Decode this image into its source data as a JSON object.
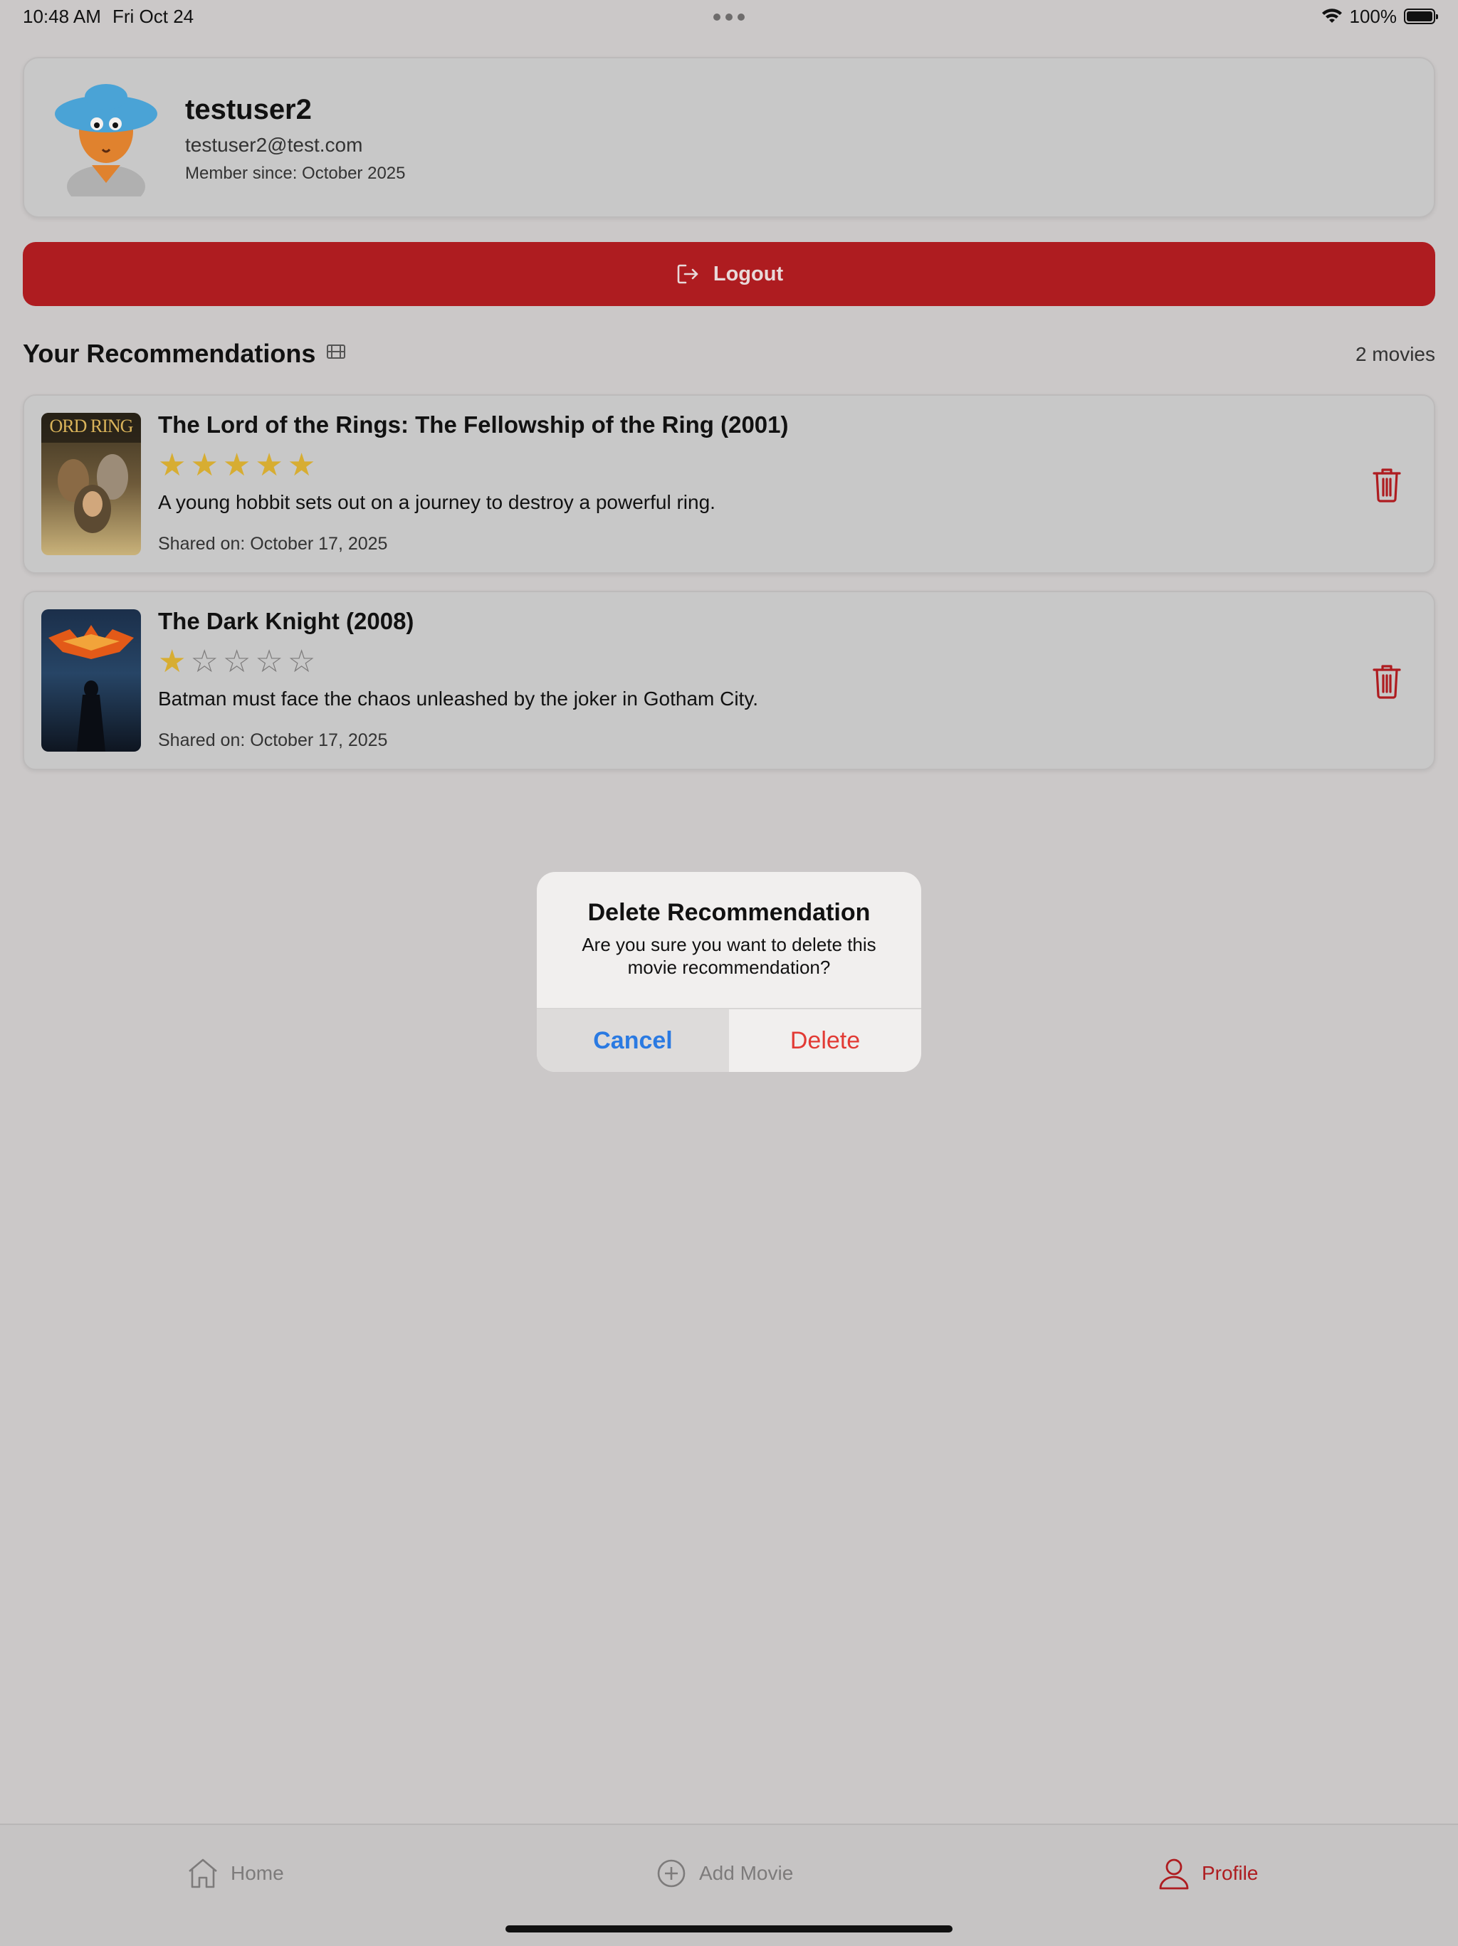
{
  "status_bar": {
    "time": "10:48 AM",
    "date": "Fri Oct 24",
    "battery": "100%"
  },
  "profile": {
    "username": "testuser2",
    "email": "testuser2@test.com",
    "member_since": "Member since: October 2025"
  },
  "logout": {
    "label": "Logout"
  },
  "recommendations": {
    "title": "Your Recommendations",
    "count": "2 movies",
    "items": [
      {
        "title": "The Lord of the Rings: The Fellowship of the Ring (2001)",
        "rating": 5,
        "description": "A young hobbit sets out on a journey to destroy a powerful ring.",
        "shared_on": "Shared on: October 17, 2025",
        "poster_text": "ORD RING"
      },
      {
        "title": "The Dark Knight (2008)",
        "rating": 1,
        "description": "Batman must face the chaos unleashed by the joker in Gotham City.",
        "shared_on": "Shared on: October 17, 2025"
      }
    ]
  },
  "dialog": {
    "title": "Delete Recommendation",
    "message": "Are you sure you want to delete this movie recommendation?",
    "cancel_label": "Cancel",
    "delete_label": "Delete"
  },
  "tabs": [
    {
      "label": "Home",
      "icon": "home-icon",
      "active": false
    },
    {
      "label": "Add Movie",
      "icon": "plus-circle-icon",
      "active": false
    },
    {
      "label": "Profile",
      "icon": "person-icon",
      "active": true
    }
  ],
  "colors": {
    "accent_red": "#ae1c20",
    "star_gold": "#d7ad32",
    "link_blue": "#2a7ae2",
    "destructive_red": "#e23a34"
  }
}
